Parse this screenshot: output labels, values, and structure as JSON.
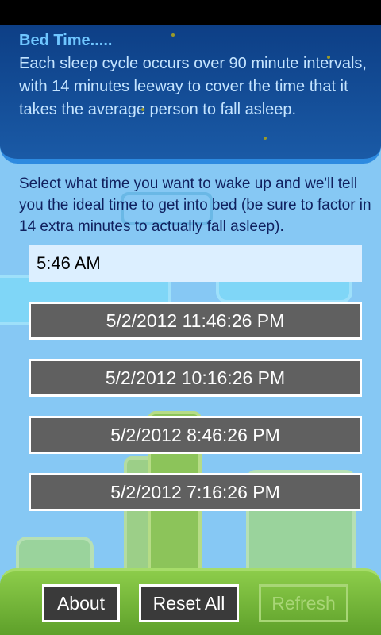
{
  "info": {
    "title": "Bed Time.....",
    "body": "Each sleep cycle occurs over 90 minute intervals, with 14 minutes leeway to cover the time that it takes the average person to fall asleep."
  },
  "prompt": "Select what time you want to wake up and we'll tell you the ideal time to get into bed (be sure to factor in 14 extra minutes to actually fall asleep).",
  "wake_time": {
    "value": "5:46 AM"
  },
  "bed_times": [
    "5/2/2012 11:46:26 PM",
    "5/2/2012 10:16:26 PM",
    "5/2/2012 8:46:26 PM",
    "5/2/2012 7:16:26 PM"
  ],
  "app_bar": {
    "about_label": "About",
    "reset_label": "Reset All",
    "refresh_label": "Refresh",
    "refresh_disabled": true
  },
  "colors": {
    "panel_bg": "#0d3f86",
    "panel_title": "#6fc6ff",
    "button_bg": "#606060",
    "sky": "#86c8f4",
    "ground": "#8ccc4a"
  }
}
